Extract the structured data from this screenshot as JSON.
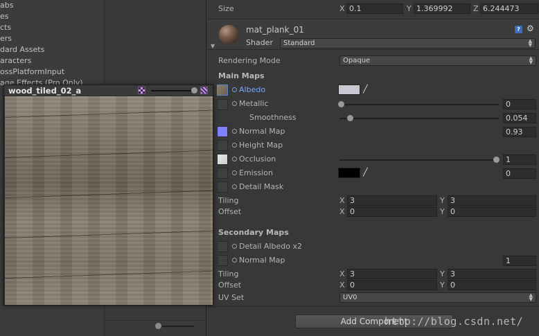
{
  "project_panel": {
    "items": [
      "abs",
      "es",
      "cts",
      "ers",
      "dard Assets",
      "aracters",
      "ossPlatformInput",
      "age Effects (Pro Only)"
    ]
  },
  "texture_preview": {
    "title": "wood_tiled_02_a"
  },
  "inspector": {
    "transform": {
      "size_label": "Size",
      "x_label": "X",
      "x_value": "0.1",
      "y_label": "Y",
      "y_value": "1.369992",
      "z_label": "Z",
      "z_value": "6.244473"
    },
    "material": {
      "name": "mat_plank_01",
      "shader_label": "Shader",
      "shader_value": "Standard",
      "help_icon": "help-icon",
      "gear_icon": "gear-icon"
    },
    "rendering_mode": {
      "label": "Rendering Mode",
      "value": "Opaque"
    },
    "main_maps": {
      "header": "Main Maps",
      "albedo": {
        "label": "Albedo",
        "color": "#c8c8d0"
      },
      "metallic": {
        "label": "Metallic",
        "value": "0",
        "slider_fraction": 0.0
      },
      "smoothness": {
        "label": "Smoothness",
        "value": "0.054",
        "slider_fraction": 0.054
      },
      "normal_map": {
        "label": "Normal Map",
        "value": "0.93",
        "thumb_color": "#8080ff"
      },
      "height_map": {
        "label": "Height Map"
      },
      "occlusion": {
        "label": "Occlusion",
        "value": "1",
        "slider_fraction": 1.0
      },
      "emission": {
        "label": "Emission",
        "value": "0",
        "color": "#000000"
      },
      "detail_mask": {
        "label": "Detail Mask"
      },
      "tiling": {
        "label": "Tiling",
        "x_label": "X",
        "x": "3",
        "y_label": "Y",
        "y": "3"
      },
      "offset": {
        "label": "Offset",
        "x_label": "X",
        "x": "0",
        "y_label": "Y",
        "y": "0"
      }
    },
    "secondary_maps": {
      "header": "Secondary Maps",
      "detail_albedo": {
        "label": "Detail Albedo x2"
      },
      "normal_map": {
        "label": "Normal Map",
        "value": "1"
      },
      "tiling": {
        "label": "Tiling",
        "x_label": "X",
        "x": "3",
        "y_label": "Y",
        "y": "3"
      },
      "offset": {
        "label": "Offset",
        "x_label": "X",
        "x": "0",
        "y_label": "Y",
        "y": "0"
      },
      "uv_set": {
        "label": "UV Set",
        "value": "UV0"
      }
    },
    "add_component_label": "Add Component"
  },
  "watermark": "http://blog.csdn.net/"
}
